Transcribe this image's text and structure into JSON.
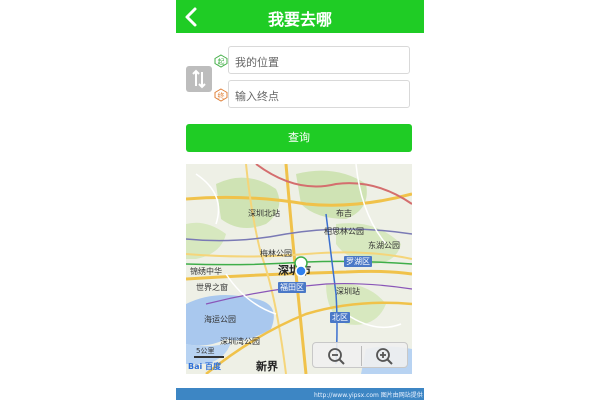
{
  "header": {
    "title": "我要去哪"
  },
  "route": {
    "start": {
      "badge": "起",
      "placeholder": "我的位置"
    },
    "end": {
      "badge": "终",
      "placeholder": "输入终点"
    }
  },
  "query_button": {
    "label": "查询"
  },
  "map": {
    "labels": {
      "shenzhen_north": "深圳北站",
      "buji": "布吉",
      "xiangmi": "相思林公园",
      "meilin": "梅林公园",
      "donghu": "东湖公园",
      "luohu": "罗湖区",
      "shenzhen": "深圳市",
      "futian": "福田区",
      "world_window": "世界之窗",
      "shenzhen_station": "深圳站",
      "jinxiu": "锦绣中华",
      "haiyun": "海运公园",
      "shenzhen_bay": "深圳湾公园",
      "xinjie": "新界",
      "beiqu": "北区"
    },
    "scale": "5公里",
    "logo": "Bai 百度"
  },
  "watermark": "http://www.yipsx.com  图片由网站提供",
  "colors": {
    "brand_green": "#1fcc25",
    "location_blue": "#2f80ed"
  }
}
